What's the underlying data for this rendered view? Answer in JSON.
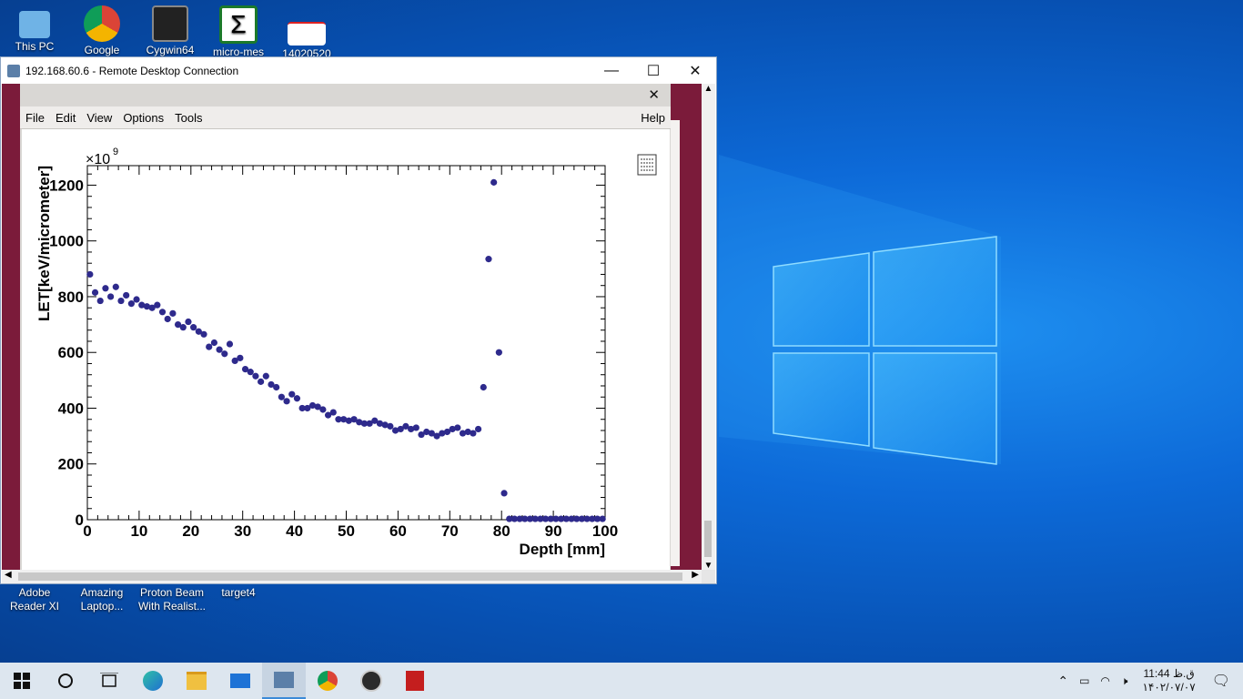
{
  "desktop": {
    "icons_top": [
      {
        "label": "This PC"
      },
      {
        "label": "Google"
      },
      {
        "label": "Cygwin64"
      },
      {
        "label": "micro-mes"
      },
      {
        "label": "14020520"
      }
    ],
    "icons_bottom": [
      {
        "label": "Adobe Reader XI"
      },
      {
        "label": "Amazing Laptop..."
      },
      {
        "label": "Proton Beam With Realist..."
      },
      {
        "label": "target4"
      }
    ]
  },
  "rdp_window": {
    "title": "192.168.60.6 - Remote Desktop Connection",
    "minimize": "—",
    "maximize": "☐",
    "close": "✕"
  },
  "root_window": {
    "close": "✕",
    "menu": [
      "File",
      "Edit",
      "View",
      "Options",
      "Tools"
    ],
    "help": "Help"
  },
  "chart_data": {
    "type": "scatter",
    "title": "",
    "xlabel": "Depth [mm]",
    "ylabel": "LET[keV/micrometer]",
    "y_multiplier": "×10",
    "y_multiplier_exp": "9",
    "xlim": [
      0,
      100
    ],
    "ylim": [
      0,
      1270
    ],
    "xticks": [
      0,
      10,
      20,
      30,
      40,
      50,
      60,
      70,
      80,
      90,
      100
    ],
    "yticks": [
      0,
      200,
      400,
      600,
      800,
      1000,
      1200
    ],
    "marker_color": "#2e2a8c",
    "x": [
      0.5,
      1.5,
      2.5,
      3.5,
      4.5,
      5.5,
      6.5,
      7.5,
      8.5,
      9.5,
      10.5,
      11.5,
      12.5,
      13.5,
      14.5,
      15.5,
      16.5,
      17.5,
      18.5,
      19.5,
      20.5,
      21.5,
      22.5,
      23.5,
      24.5,
      25.5,
      26.5,
      27.5,
      28.5,
      29.5,
      30.5,
      31.5,
      32.5,
      33.5,
      34.5,
      35.5,
      36.5,
      37.5,
      38.5,
      39.5,
      40.5,
      41.5,
      42.5,
      43.5,
      44.5,
      45.5,
      46.5,
      47.5,
      48.5,
      49.5,
      50.5,
      51.5,
      52.5,
      53.5,
      54.5,
      55.5,
      56.5,
      57.5,
      58.5,
      59.5,
      60.5,
      61.5,
      62.5,
      63.5,
      64.5,
      65.5,
      66.5,
      67.5,
      68.5,
      69.5,
      70.5,
      71.5,
      72.5,
      73.5,
      74.5,
      75.5,
      76.5,
      77.5,
      78.5,
      79.5,
      80.5,
      81.5,
      82.5,
      83.5,
      84.5,
      85.5,
      86.5,
      87.5,
      88.5,
      89.5,
      90.5,
      91.5,
      92.5,
      93.5,
      94.5,
      95.5,
      96.5,
      97.5,
      98.5,
      99.5
    ],
    "y": [
      880,
      815,
      785,
      830,
      800,
      835,
      785,
      805,
      775,
      790,
      770,
      765,
      760,
      770,
      745,
      720,
      740,
      700,
      690,
      710,
      690,
      675,
      665,
      620,
      635,
      610,
      595,
      630,
      570,
      580,
      540,
      530,
      515,
      495,
      515,
      485,
      475,
      440,
      425,
      450,
      435,
      400,
      400,
      410,
      405,
      395,
      375,
      385,
      360,
      360,
      355,
      360,
      350,
      345,
      345,
      355,
      345,
      340,
      335,
      320,
      325,
      335,
      325,
      330,
      305,
      315,
      310,
      300,
      310,
      315,
      325,
      330,
      310,
      315,
      310,
      325,
      475,
      935,
      1210,
      600,
      95,
      3,
      3,
      3,
      3,
      3,
      3,
      3,
      3,
      3,
      3,
      3,
      3,
      3,
      3,
      3,
      3,
      3,
      3,
      3
    ]
  },
  "taskbar": {
    "clock_time": "11:44 ق.ظ",
    "clock_date": "۱۴۰۲/۰۷/۰۷"
  }
}
